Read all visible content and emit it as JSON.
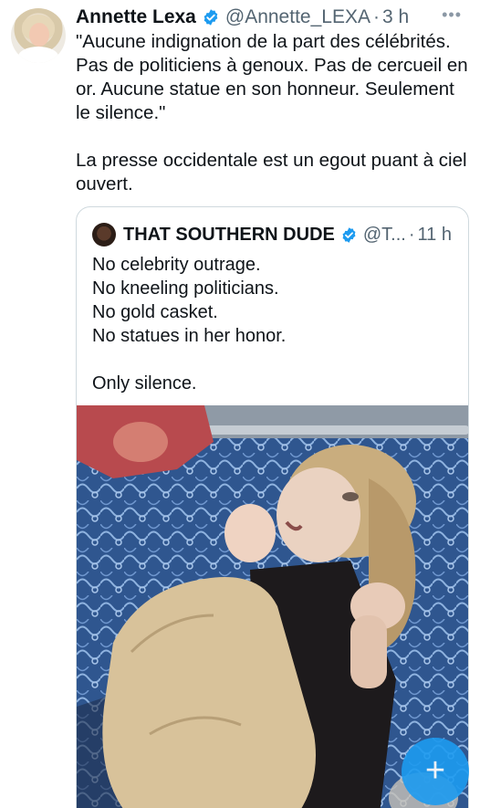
{
  "tweet": {
    "author_name": "Annette Lexa",
    "handle": "@Annette_LEXA",
    "separator": "·",
    "time": "3 h",
    "more_label": "•••",
    "text": "\"Aucune indignation de la part des célébrités. Pas de politiciens à genoux. Pas de cercueil en or. Aucune statue en son honneur.  Seulement le silence.\"\n\nLa presse occidentale est un egout puant à ciel ouvert."
  },
  "quoted_tweet": {
    "author_name": "THAT SOUTHERN DUDE",
    "handle": "@T...",
    "separator": "·",
    "time": "11 h",
    "text": "No celebrity outrage.\nNo kneeling politicians.\nNo gold casket.\nNo statues in her honor.\n\nOnly silence."
  },
  "fab": {
    "label": "+"
  },
  "icons": {
    "verified": "verified-badge-icon",
    "more": "more-icon",
    "compose": "plus-icon"
  },
  "colors": {
    "verified_blue": "#1d9bf0",
    "fab_blue": "#1d9bf0",
    "secondary_text": "#536471"
  }
}
